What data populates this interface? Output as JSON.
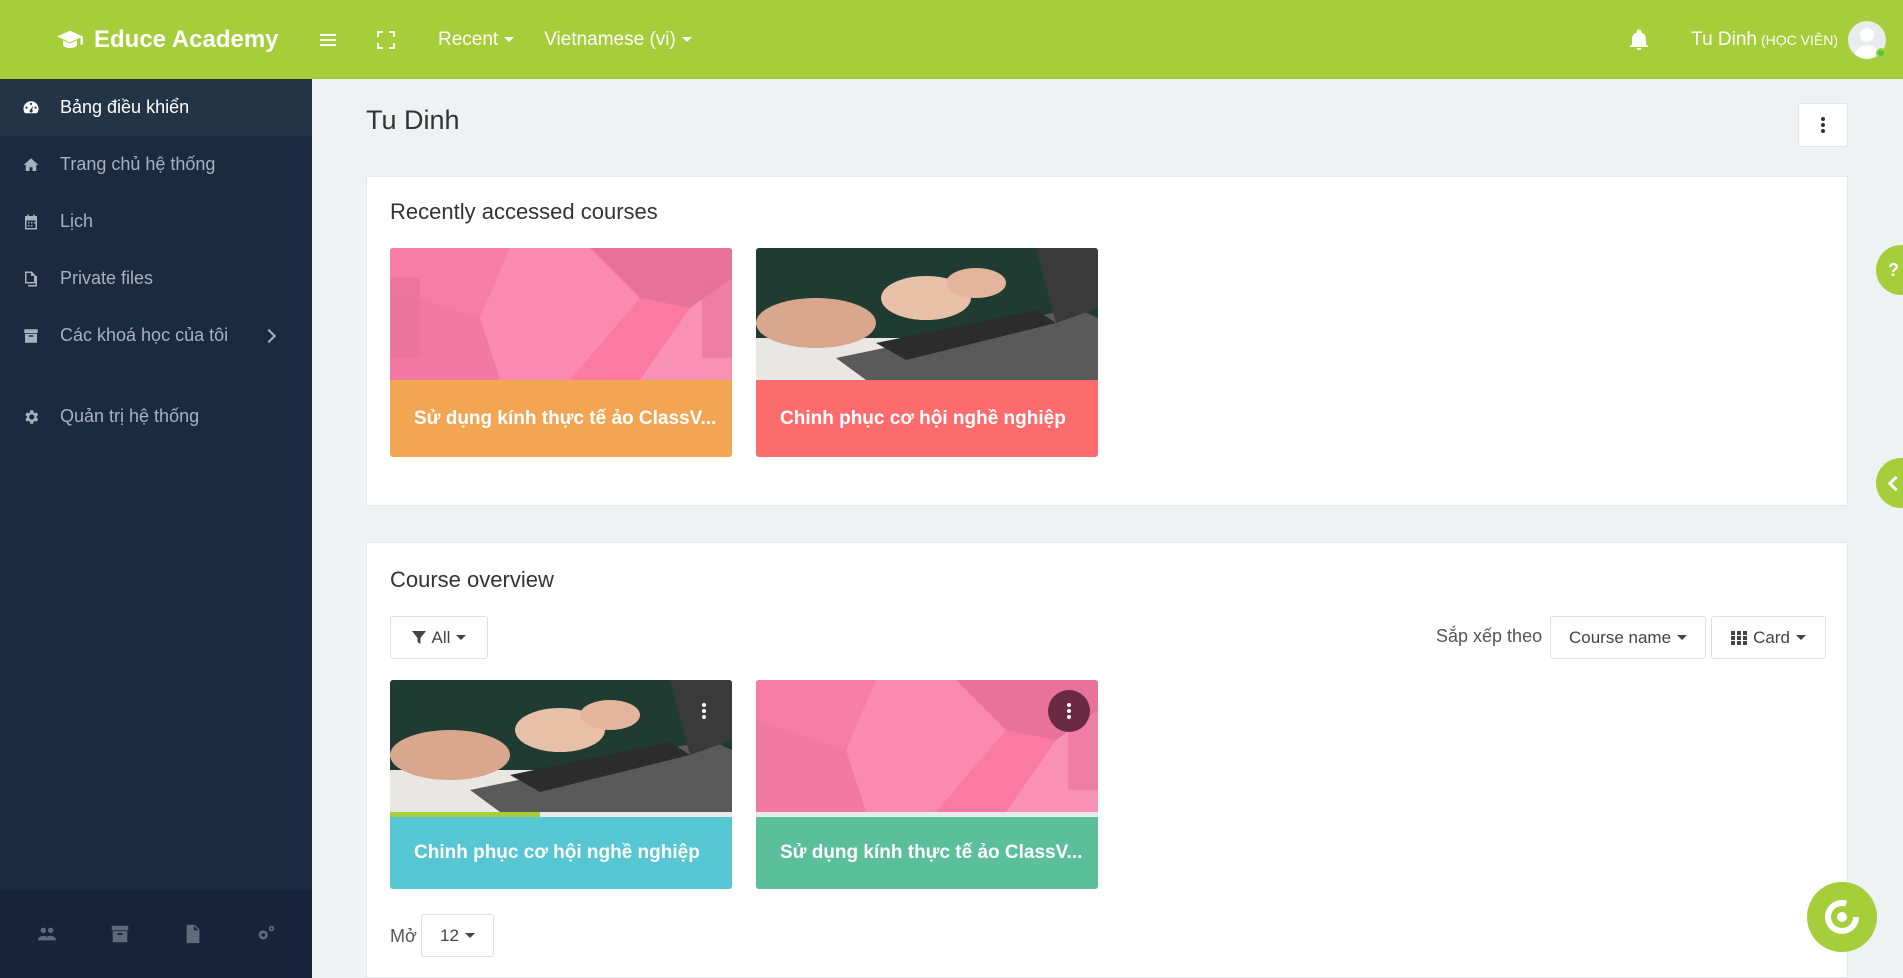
{
  "topbar": {
    "brand": "Educe Academy",
    "recent_label": "Recent",
    "language_label": "Vietnamese (vi)",
    "user_name": "Tu Dinh",
    "user_role": "(HỌC VIÊN)"
  },
  "sidebar": {
    "items": [
      {
        "label": "Bảng điều khiển",
        "icon": "dashboard-icon",
        "active": true
      },
      {
        "label": "Trang chủ hệ thống",
        "icon": "home-icon"
      },
      {
        "label": "Lịch",
        "icon": "calendar-icon"
      },
      {
        "label": "Private files",
        "icon": "files-icon"
      },
      {
        "label": "Các khoá học của tôi",
        "icon": "archive-icon"
      },
      {
        "label": "Quản trị hệ thống",
        "icon": "gear-icon"
      }
    ],
    "footer_icons": [
      "users-icon",
      "archive-icon",
      "file-icon",
      "gears-icon"
    ]
  },
  "main": {
    "page_title": "Tu Dinh",
    "recent": {
      "title": "Recently accessed courses",
      "courses": [
        {
          "name": "Sử dụng kính thực tế ảo ClassV...",
          "color": "#f2a654",
          "image": "pink-pattern"
        },
        {
          "name": "Chinh phục cơ hội nghề nghiệp",
          "color": "#fc6c6c",
          "image": "laptop-photo"
        }
      ]
    },
    "overview": {
      "title": "Course overview",
      "filter_label": "All",
      "sort_label": "Sắp xếp theo",
      "sort_value": "Course name",
      "view_value": "Card",
      "courses": [
        {
          "name": "Chinh phục cơ hội nghề nghiệp",
          "color": "#57c6d3",
          "image": "laptop-photo",
          "progress": 0.44
        },
        {
          "name": "Sử dụng kính thực tế ảo ClassV...",
          "color": "#5bbf9a",
          "image": "pink-pattern",
          "progress": 0
        }
      ],
      "show_label": "Mở",
      "show_value": "12"
    },
    "help_label": "?"
  }
}
